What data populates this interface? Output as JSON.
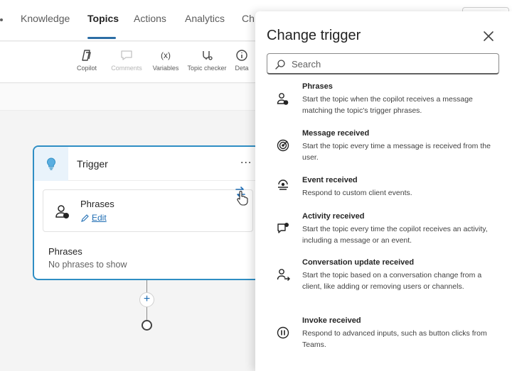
{
  "nav": {
    "tabs": [
      {
        "label": "Knowledge",
        "active": false
      },
      {
        "label": "Topics",
        "active": true
      },
      {
        "label": "Actions",
        "active": false
      },
      {
        "label": "Analytics",
        "active": false
      },
      {
        "label": "Ch",
        "active": false
      }
    ]
  },
  "toolbar": {
    "items": [
      {
        "label": "Copilot",
        "icon": "copilot-icon",
        "disabled": false
      },
      {
        "label": "Comments",
        "icon": "comment-icon",
        "disabled": true
      },
      {
        "label": "Variables",
        "icon": "variables-icon",
        "disabled": false
      },
      {
        "label": "Topic checker",
        "icon": "topic-checker-icon",
        "disabled": false
      },
      {
        "label": "Deta",
        "icon": "info-icon",
        "disabled": false
      }
    ]
  },
  "canvas": {
    "trigger_node": {
      "title": "Trigger",
      "more": "...",
      "phrases_box": {
        "title": "Phrases",
        "edit_label": "Edit"
      },
      "section_title": "Phrases",
      "section_empty": "No phrases to show"
    },
    "add_label": "+"
  },
  "panel": {
    "title": "Change trigger",
    "search_placeholder": "Search",
    "options": [
      {
        "name": "Phrases",
        "icon": "phrases-icon",
        "description": "Start the topic when the copilot receives a message matching the topic's trigger phrases."
      },
      {
        "name": "Message received",
        "icon": "message-received-icon",
        "description": "Start the topic every time a message is received from the user."
      },
      {
        "name": "Event received",
        "icon": "event-received-icon",
        "description": "Respond to custom client events."
      },
      {
        "name": "Activity received",
        "icon": "activity-received-icon",
        "description": "Start the topic every time the copilot receives an activity, including a message or an event."
      },
      {
        "name": "Conversation update received",
        "icon": "conversation-update-icon",
        "description": "Start the topic based on a conversation change from a client, like adding or removing users or channels."
      },
      {
        "name": "Invoke received",
        "icon": "invoke-received-icon",
        "description": "Respond to advanced inputs, such as button clicks from Teams."
      }
    ]
  },
  "colors": {
    "accent": "#2f8ec4",
    "link": "#1d6cb3",
    "tab_underline": "#2c6ea5"
  }
}
